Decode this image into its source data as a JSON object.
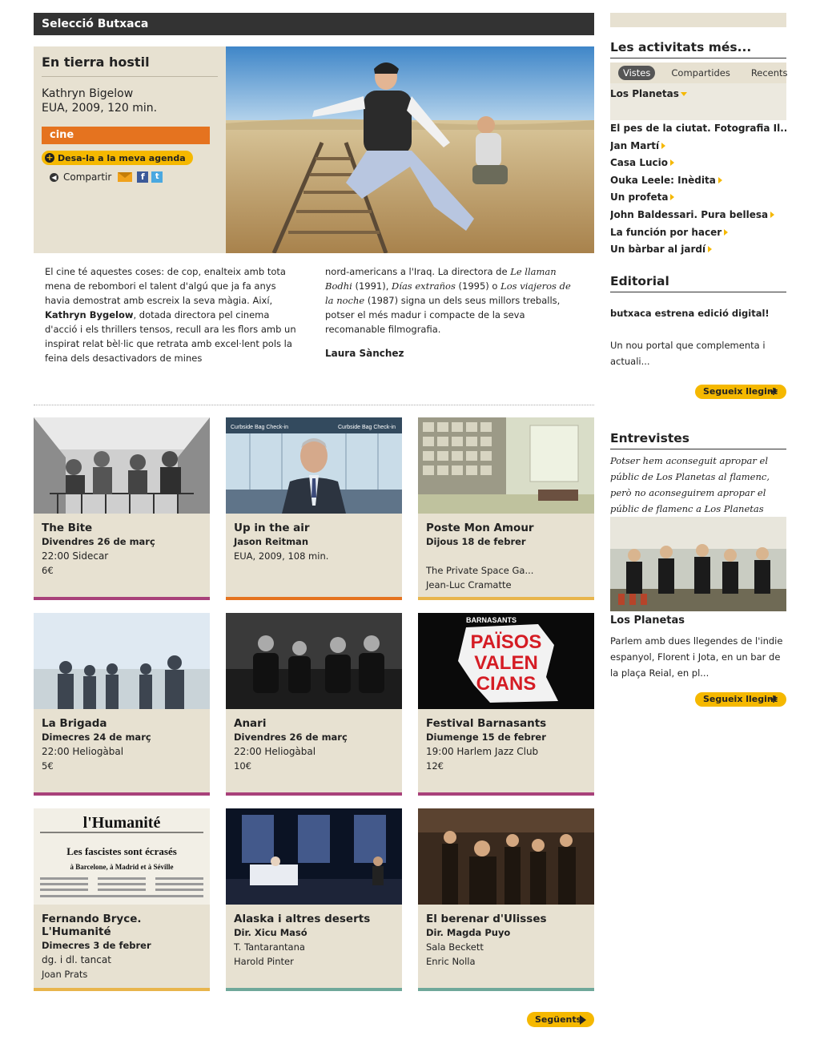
{
  "header": {
    "title": "Selecció Butxaca"
  },
  "featured": {
    "title": "En tierra hostil",
    "director": "Kathryn Bigelow",
    "meta": "EUA, 2009, 120 min.",
    "category": "cine",
    "agenda_label": "Desa-la a la meva agenda",
    "share_label": "Compartir",
    "text_col1_a": "El cine té aquestes coses: de cop, enalteix amb tota mena de rebombori el talent d'algú que ja fa anys havia demostrat amb escreix la seva màgia. Així,",
    "text_col1_b": "Kathryn Bygelow",
    "text_col1_c": ", dotada directora pel cinema d'acció i els thrillers tensos, recull ara les flors amb un inspirat relat bèl·lic que retrata amb excel·lent pols la feina dels desactivadors de mines",
    "text_col2_a": "nord-americans a l'Iraq. La directora de",
    "text_col2_t1": "Le llaman Bodhi",
    "text_col2_b": "(1991),",
    "text_col2_t2": "Días extraños",
    "text_col2_c": "(1995) o",
    "text_col2_t3": "Los viajeros de la noche",
    "text_col2_d": "(1987) signa un dels seus millors treballs, potser el més madur i compacte de la seva recomanable filmografia.",
    "author": "Laura Sànchez"
  },
  "cards": [
    {
      "title": "The Bite",
      "line1": "Divendres 26 de març",
      "line2": "22:00   Sidecar",
      "line3": "6€",
      "line4": "",
      "bar": "#a8417a"
    },
    {
      "title": "Up in the air",
      "line1": "Jason Reitman",
      "line2": "EUA, 2009, 108 min.",
      "line3": "",
      "line4": "",
      "bar": "#e5731f"
    },
    {
      "title": "Poste Mon Amour",
      "line1": "Dijous 18 de febrer",
      "line2": "",
      "line3": "The Private Space Ga...",
      "line4": "Jean-Luc Cramatte",
      "bar": "#e8b54c"
    },
    {
      "title": "La Brigada",
      "line1": "Dimecres 24 de març",
      "line2": "22:00   Heliogàbal",
      "line3": "5€",
      "line4": "",
      "bar": "#a8417a"
    },
    {
      "title": "Anari",
      "line1": "Divendres 26 de març",
      "line2": "22:00   Heliogàbal",
      "line3": "10€",
      "line4": "",
      "bar": "#a8417a"
    },
    {
      "title": "Festival Barnasants",
      "line1": "Diumenge 15 de febrer",
      "line2": "19:00   Harlem Jazz Club",
      "line3": "12€",
      "line4": "",
      "bar": "#a8417a"
    },
    {
      "title": "Fernando Bryce. L'Humanité",
      "line1": "Dimecres 3 de febrer",
      "line2": "dg. i dl. tancat",
      "line3": "Joan Prats",
      "line4": "",
      "bar": "#e8b54c"
    },
    {
      "title": "Alaska i altres deserts",
      "line1": "Dir. Xicu Masó",
      "line2": "T. Tantarantana",
      "line3": "Harold Pinter",
      "line4": "",
      "bar": "#6fa89a"
    },
    {
      "title": "El berenar d'Ulisses",
      "line1": "Dir. Magda Puyo",
      "line2": "Sala Beckett",
      "line3": "Enric Nolla",
      "line4": "",
      "bar": "#6fa89a"
    }
  ],
  "card_images": {
    "barnasants_top": "BARNASANTS",
    "barnasants_text1": "PAÏSOS",
    "barnasants_text2": "VALEN",
    "barnasants_text3": "CIANS",
    "humanite_masthead": "l'Humanité",
    "humanite_headline": "Les fascistes sont écrasés",
    "humanite_sub": "à Barcelone, à Madrid et à Séville",
    "upinair_sign_left": "Curbside Bag Check-in",
    "upinair_sign_right": "Curbside Bag Check-in"
  },
  "next_label": "Següents",
  "sidebar": {
    "activities_title": "Les activitats més...",
    "tabs": [
      "Vistes",
      "Compartides",
      "Recents"
    ],
    "active_tab_item": "Los Planetas",
    "links": [
      "El pes de la ciutat. Fotografia Il...",
      "Jan Martí",
      "Casa Lucio",
      "Ouka Leele: Inèdita",
      "Un profeta",
      "John Baldessari. Pura bellesa",
      "La función por hacer",
      "Un bàrbar al jardí"
    ],
    "editorial_title": "Editorial",
    "editorial_headline": "butxaca estrena edició digital!",
    "editorial_text": "Un nou portal que complementa i actuali...",
    "more_label": "Segueix llegint",
    "interviews_title": "Entrevistes",
    "interview_quote": "Potser hem aconseguit apropar el públic de Los Planetas al flamenc, però no aconseguirem apropar el públic de flamenc a Los Planetas",
    "interview_name": "Los Planetas",
    "interview_text": "Parlem amb dues llegendes de l'indie espanyol, Florent i Jota, en un bar de la plaça Reial, en pl...",
    "more_label2": "Segueix llegint"
  }
}
